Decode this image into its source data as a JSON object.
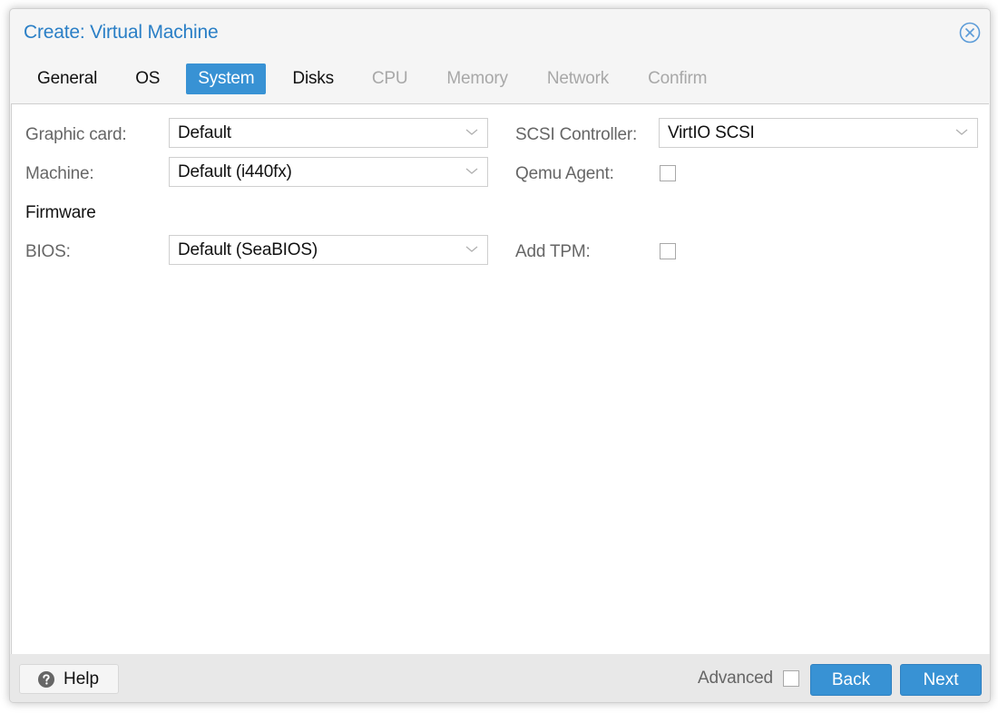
{
  "dialog": {
    "title": "Create: Virtual Machine",
    "close_icon": "close-circle-icon"
  },
  "tabs": [
    {
      "label": "General",
      "state": "enabled"
    },
    {
      "label": "OS",
      "state": "enabled"
    },
    {
      "label": "System",
      "state": "active"
    },
    {
      "label": "Disks",
      "state": "enabled"
    },
    {
      "label": "CPU",
      "state": "disabled"
    },
    {
      "label": "Memory",
      "state": "disabled"
    },
    {
      "label": "Network",
      "state": "disabled"
    },
    {
      "label": "Confirm",
      "state": "disabled"
    }
  ],
  "form": {
    "graphic_card": {
      "label": "Graphic card:",
      "value": "Default"
    },
    "machine": {
      "label": "Machine:",
      "value": "Default (i440fx)"
    },
    "firmware_section": "Firmware",
    "bios": {
      "label": "BIOS:",
      "value": "Default (SeaBIOS)"
    },
    "scsi_controller": {
      "label": "SCSI Controller:",
      "value": "VirtIO SCSI"
    },
    "qemu_agent": {
      "label": "Qemu Agent:",
      "checked": false
    },
    "add_tpm": {
      "label": "Add TPM:",
      "checked": false
    }
  },
  "footer": {
    "help_label": "Help",
    "help_icon": "question-circle-icon",
    "advanced_label": "Advanced",
    "advanced_checked": false,
    "back_label": "Back",
    "next_label": "Next"
  },
  "colors": {
    "accent": "#3892d4",
    "title": "#2a7fc6",
    "disabled_tab": "#a8a8a8"
  }
}
